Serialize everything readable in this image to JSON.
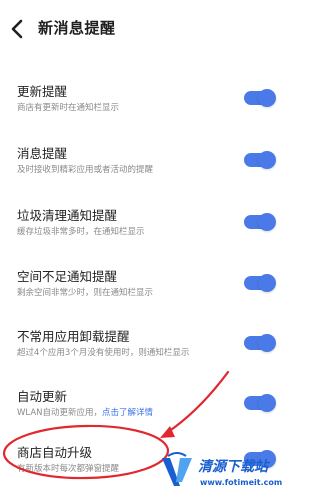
{
  "header": {
    "title": "新消息提醒",
    "back_icon": "chevron-left-icon"
  },
  "settings": [
    {
      "title": "更新提醒",
      "desc": "商店有更新时在通知栏显示",
      "toggle_on": true
    },
    {
      "title": "消息提醒",
      "desc": "及时接收到精彩应用或者活动的提醒",
      "toggle_on": true
    },
    {
      "title": "垃圾清理通知提醒",
      "desc": "缓存垃圾非常多时，在通知栏显示",
      "toggle_on": true
    },
    {
      "title": "空间不足通知提醒",
      "desc": "剩余空间非常少时，则在通知栏显示",
      "toggle_on": true
    },
    {
      "title": "不常用应用卸载提醒",
      "desc": "超过4个应用3个月没有使用时，则通知栏显示",
      "toggle_on": true
    },
    {
      "title": "自动更新",
      "desc": "WLAN自动更新应用，",
      "link": "点击了解详情",
      "toggle_on": true
    },
    {
      "title": "商店自动升级",
      "desc": "有新版本时每次都弹窗提醒",
      "toggle_on": true
    }
  ],
  "colors": {
    "accent": "#4a7ae8",
    "annotation": "#e0282e"
  },
  "watermark": {
    "text": "清源下载站",
    "url": "www.fotimeit.com"
  }
}
